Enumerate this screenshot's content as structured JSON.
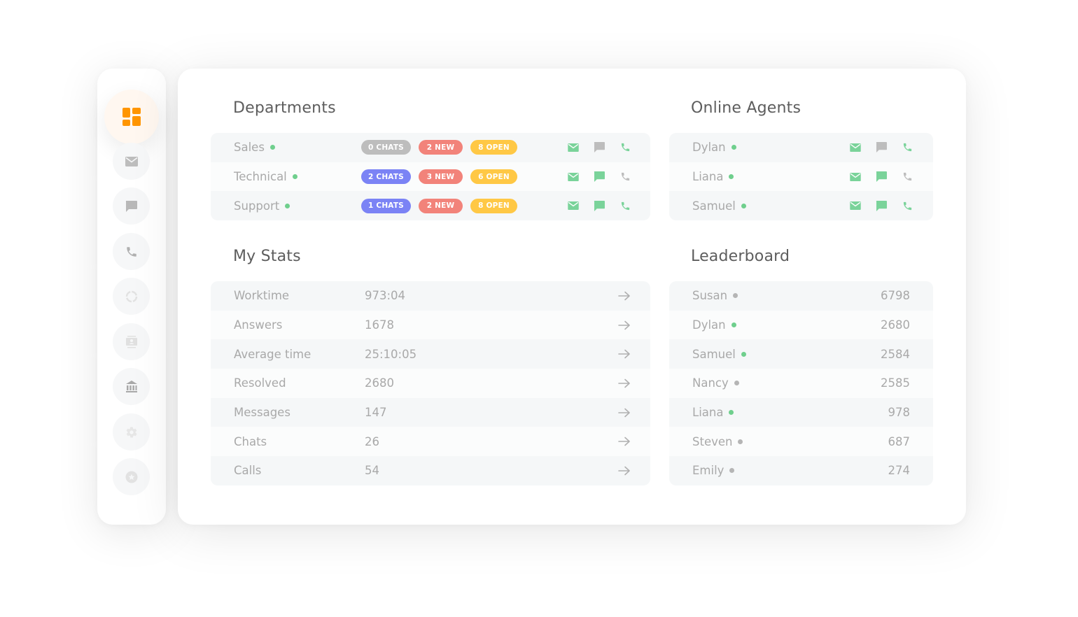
{
  "colors": {
    "accent": "#ff9500",
    "online": "#6fcf8d",
    "offline": "#b5b5b5",
    "icon_active": "#7ad39a",
    "icon_inactive": "#bdbdbd",
    "badge_gray": "#bdbdbd",
    "badge_blue": "#7b83f5",
    "badge_red": "#f2837a",
    "badge_yellow": "#ffc845"
  },
  "sidebar": {
    "items": [
      {
        "icon": "dashboard-icon",
        "active": true
      },
      {
        "icon": "mail-icon",
        "active": false
      },
      {
        "icon": "chat-icon",
        "active": false
      },
      {
        "icon": "phone-icon",
        "active": false
      },
      {
        "icon": "loading-icon",
        "active": false
      },
      {
        "icon": "contact-card-icon",
        "active": false
      },
      {
        "icon": "bank-icon",
        "active": false
      },
      {
        "icon": "settings-icon",
        "active": false
      },
      {
        "icon": "star-icon",
        "active": false
      }
    ]
  },
  "departments": {
    "title": "Departments",
    "rows": [
      {
        "name": "Sales",
        "online": true,
        "chats": "0 CHATS",
        "chats_color": "gray",
        "new": "2 NEW",
        "open": "8 OPEN",
        "mail": true,
        "chat": false,
        "phone": true
      },
      {
        "name": "Technical",
        "online": true,
        "chats": "2 CHATS",
        "chats_color": "blue",
        "new": "3 NEW",
        "open": "6 OPEN",
        "mail": true,
        "chat": true,
        "phone": false
      },
      {
        "name": "Support",
        "online": true,
        "chats": "1 CHATS",
        "chats_color": "blue",
        "new": "2 NEW",
        "open": "8 OPEN",
        "mail": true,
        "chat": true,
        "phone": true
      }
    ]
  },
  "online_agents": {
    "title": "Online Agents",
    "rows": [
      {
        "name": "Dylan",
        "online": true,
        "mail": true,
        "chat": false,
        "phone": true
      },
      {
        "name": "Liana",
        "online": true,
        "mail": true,
        "chat": true,
        "phone": false
      },
      {
        "name": "Samuel",
        "online": true,
        "mail": true,
        "chat": true,
        "phone": true
      }
    ]
  },
  "my_stats": {
    "title": "My Stats",
    "rows": [
      {
        "label": "Worktime",
        "value": "973:04"
      },
      {
        "label": "Answers",
        "value": "1678"
      },
      {
        "label": "Average time",
        "value": "25:10:05"
      },
      {
        "label": "Resolved",
        "value": "2680"
      },
      {
        "label": "Messages",
        "value": "147"
      },
      {
        "label": "Chats",
        "value": "26"
      },
      {
        "label": "Calls",
        "value": "54"
      }
    ]
  },
  "leaderboard": {
    "title": "Leaderboard",
    "rows": [
      {
        "name": "Susan",
        "online": false,
        "score": "6798"
      },
      {
        "name": "Dylan",
        "online": true,
        "score": "2680"
      },
      {
        "name": "Samuel",
        "online": true,
        "score": "2584"
      },
      {
        "name": "Nancy",
        "online": false,
        "score": "2585"
      },
      {
        "name": "Liana",
        "online": true,
        "score": "978"
      },
      {
        "name": "Steven",
        "online": false,
        "score": "687"
      },
      {
        "name": "Emily",
        "online": false,
        "score": "274"
      }
    ]
  }
}
